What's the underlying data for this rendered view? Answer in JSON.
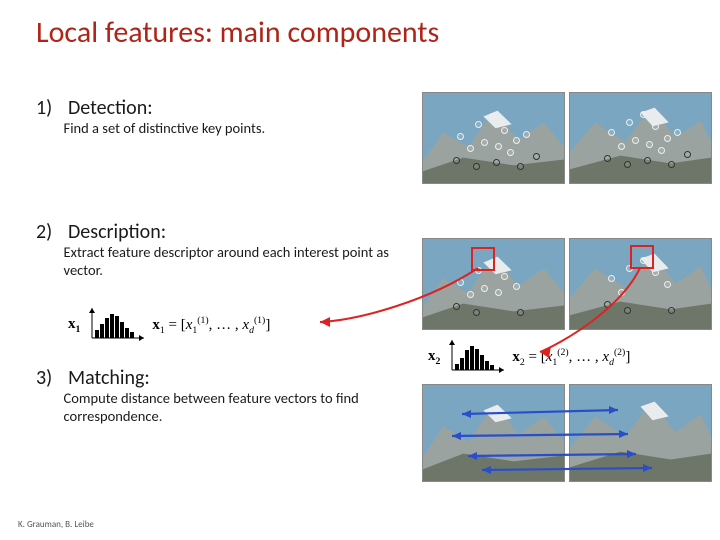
{
  "title": "Local features: main components",
  "sections": [
    {
      "num": "1)",
      "head": "Detection:",
      "desc": "Find a set of distinctive key points."
    },
    {
      "num": "2)",
      "head": "Description:",
      "desc": "Extract feature descriptor around each interest point as vector."
    },
    {
      "num": "3)",
      "head": "Matching:",
      "desc": "Compute distance between feature vectors to find correspondence."
    }
  ],
  "formulae": {
    "x1_sym": "x",
    "x1_sub": "1",
    "x1_vec": "x₁ = [x₁⁽¹⁾, … , x_d⁽¹⁾]",
    "x2_sym": "x",
    "x2_sub": "2",
    "x2_vec": "x₂ = [x₁⁽²⁾, … , x_d⁽²⁾]"
  },
  "credit": "K. Grauman, B. Leibe"
}
